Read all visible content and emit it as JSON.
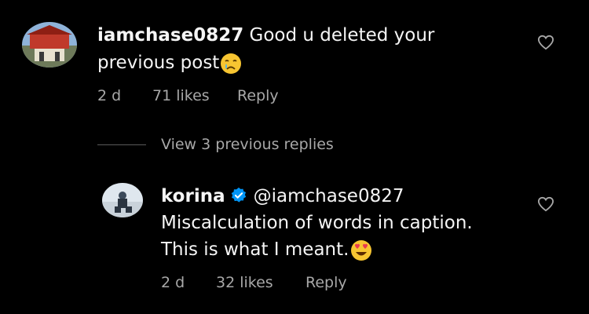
{
  "comment": {
    "username": "iamchase0827",
    "text_line1": "Good u deleted your",
    "text_line2": "previous post",
    "emoji": "crying-face",
    "time": "2 d",
    "likes": "71 likes",
    "reply_label": "Reply"
  },
  "view_replies": {
    "label": "View 3 previous replies"
  },
  "reply": {
    "username": "korina",
    "verified": true,
    "mention": "@iamchase0827",
    "text_line1": "Miscalculation of words in caption.",
    "text_line2": "This is what I meant.",
    "emoji": "heart-eyes-face",
    "time": "2 d",
    "likes": "32 likes",
    "reply_label": "Reply"
  },
  "colors": {
    "background": "#000000",
    "text": "#f5f5f5",
    "meta": "#a8a8a8",
    "verified": "#0095f6"
  }
}
